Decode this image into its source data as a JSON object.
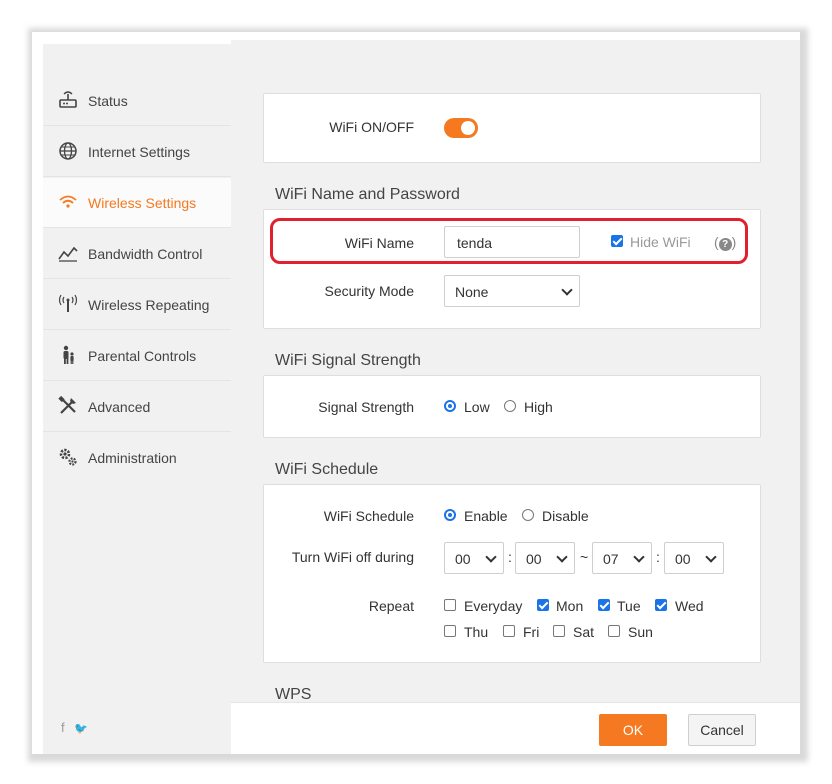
{
  "sidebar": {
    "items": [
      {
        "label": "Status",
        "icon": "router-icon",
        "active": false
      },
      {
        "label": "Internet Settings",
        "icon": "globe-icon",
        "active": false
      },
      {
        "label": "Wireless Settings",
        "icon": "wifi-icon",
        "active": true
      },
      {
        "label": "Bandwidth Control",
        "icon": "bandwidth-icon",
        "active": false
      },
      {
        "label": "Wireless Repeating",
        "icon": "antenna-icon",
        "active": false
      },
      {
        "label": "Parental Controls",
        "icon": "family-icon",
        "active": false
      },
      {
        "label": "Advanced",
        "icon": "tools-icon",
        "active": false
      },
      {
        "label": "Administration",
        "icon": "gears-icon",
        "active": false
      }
    ],
    "social": {
      "facebook": "f",
      "twitter": "🐦"
    }
  },
  "wifi_onoff": {
    "label": "WiFi ON/OFF",
    "state": "on"
  },
  "name_password": {
    "title": "WiFi Name and Password",
    "wifi_name_label": "WiFi Name",
    "wifi_name_value": "tenda",
    "hide_wifi_label": "Hide WiFi",
    "hide_wifi_checked": true,
    "help_glyph": "?",
    "security_mode_label": "Security Mode",
    "security_mode_value": "None"
  },
  "signal": {
    "title": "WiFi Signal Strength",
    "label": "Signal Strength",
    "options": [
      "Low",
      "High"
    ],
    "selected": "Low"
  },
  "schedule": {
    "title": "WiFi Schedule",
    "label": "WiFi Schedule",
    "options": [
      "Enable",
      "Disable"
    ],
    "selected": "Enable",
    "off_during_label": "Turn WiFi off during",
    "start_hour": "00",
    "start_min": "00",
    "end_hour": "07",
    "end_min": "00",
    "colon": ":",
    "tilde": "~",
    "repeat_label": "Repeat",
    "days": [
      {
        "label": "Everyday",
        "checked": false
      },
      {
        "label": "Mon",
        "checked": true
      },
      {
        "label": "Tue",
        "checked": true
      },
      {
        "label": "Wed",
        "checked": true
      },
      {
        "label": "Thu",
        "checked": false
      },
      {
        "label": "Fri",
        "checked": false
      },
      {
        "label": "Sat",
        "checked": false
      },
      {
        "label": "Sun",
        "checked": false
      }
    ]
  },
  "wps": {
    "title": "WPS"
  },
  "footer": {
    "ok": "OK",
    "cancel": "Cancel"
  },
  "colors": {
    "accent": "#f47920",
    "highlight": "#e0202e",
    "checkbox": "#1a73e8"
  }
}
